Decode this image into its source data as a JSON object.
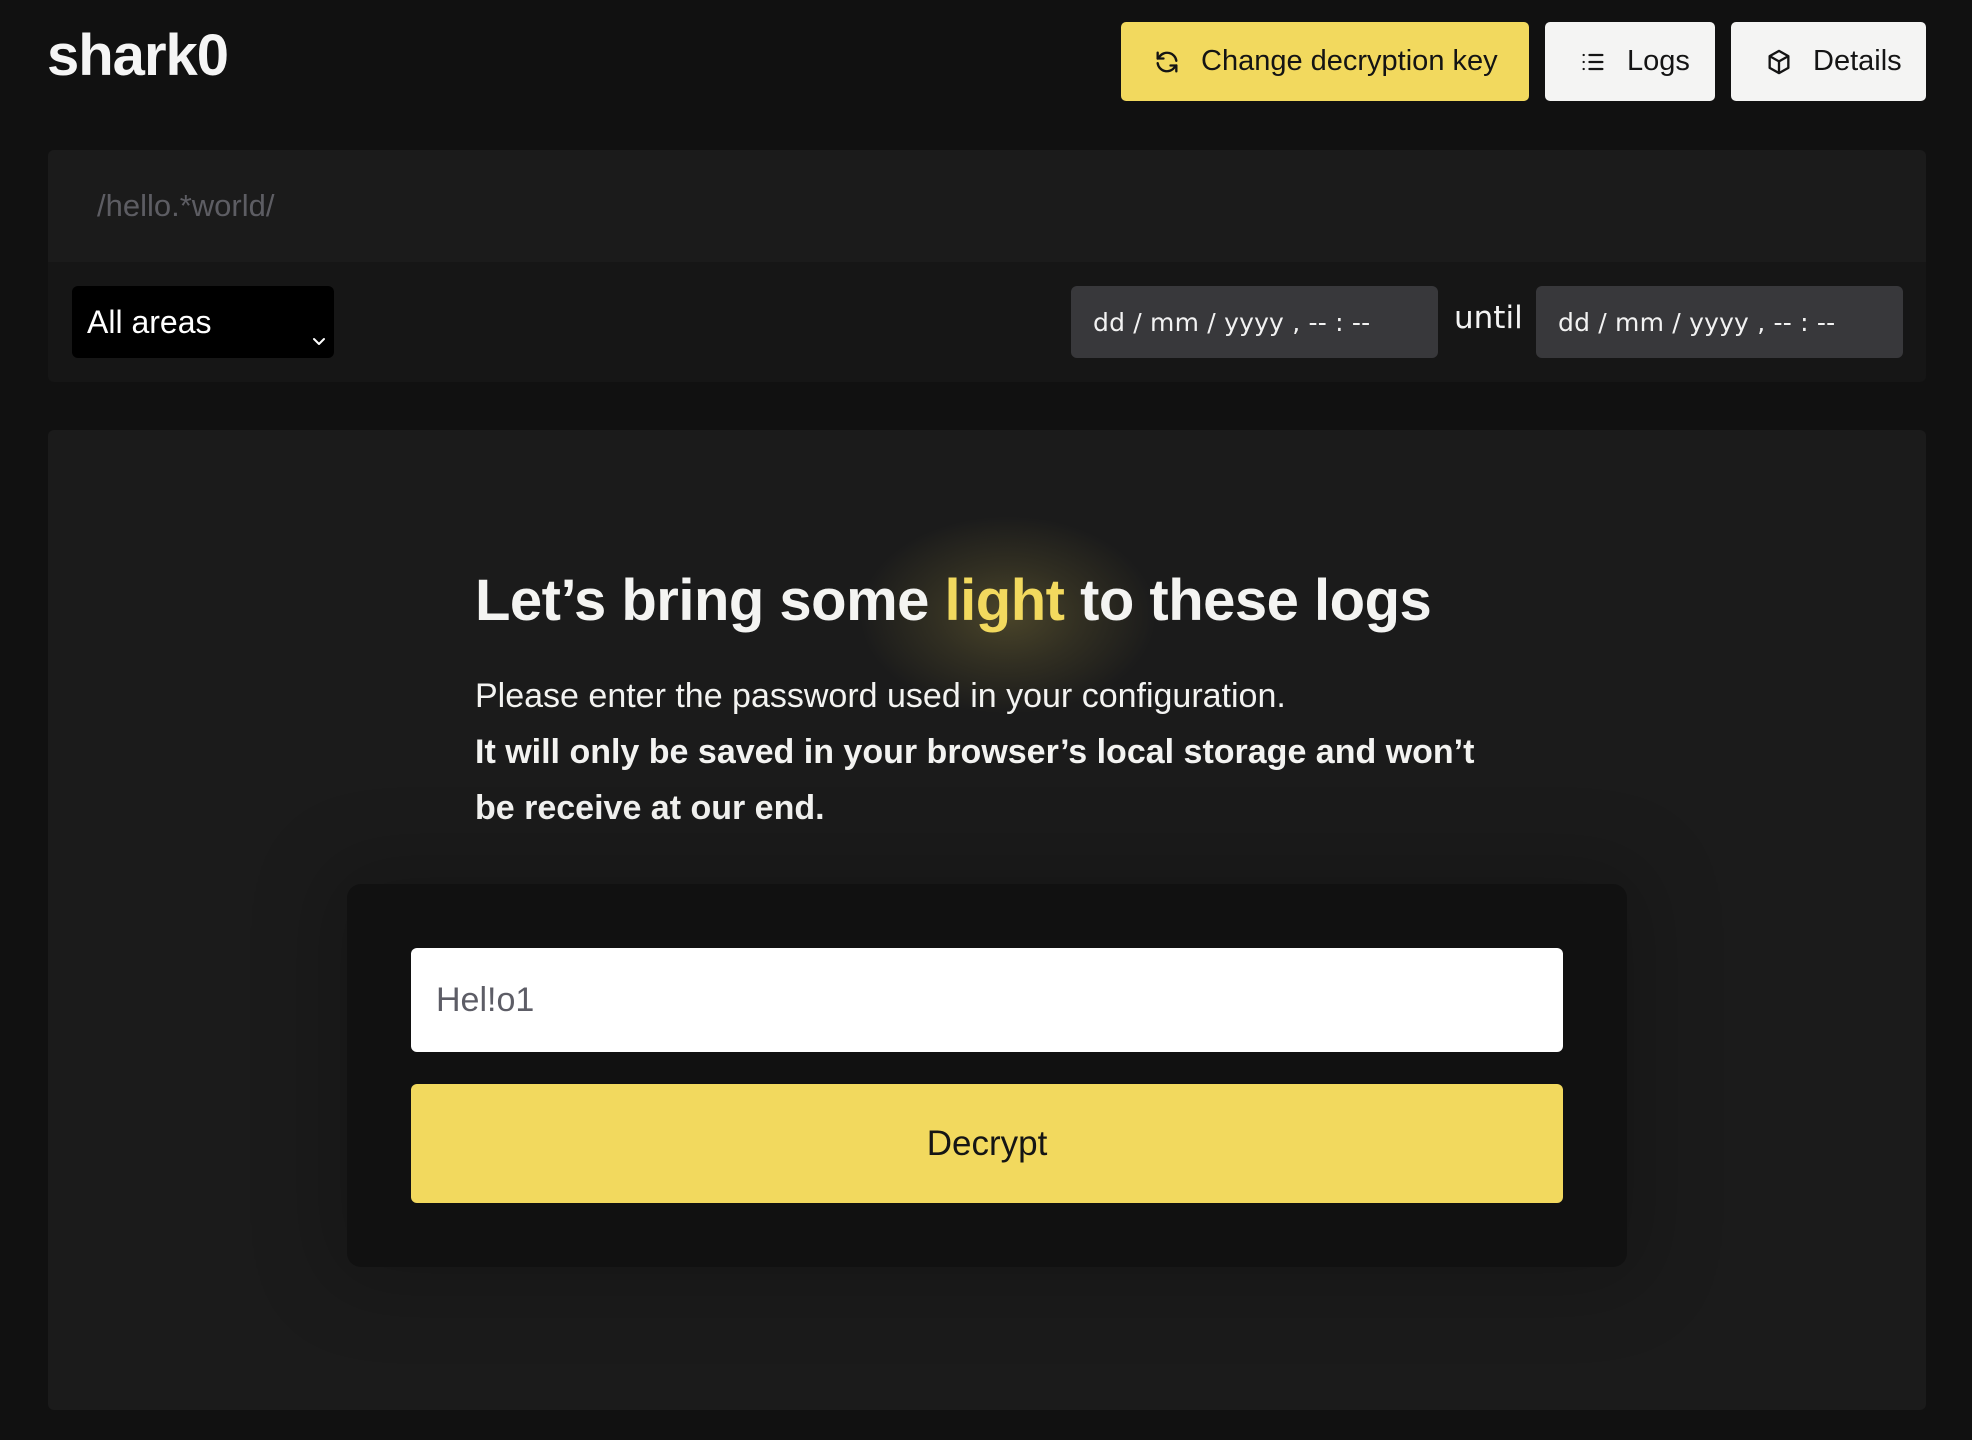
{
  "app": {
    "logo": "shark0"
  },
  "header": {
    "buttons": [
      {
        "label": "Change decryption key",
        "icon": "refresh-icon",
        "variant": "primary"
      },
      {
        "label": "Logs",
        "icon": "list-icon",
        "variant": "secondary"
      },
      {
        "label": "Details",
        "icon": "cube-icon",
        "variant": "secondary"
      }
    ]
  },
  "filters": {
    "search": {
      "value": "",
      "placeholder": "/hello.*world/"
    },
    "area_select": {
      "selected": "All areas"
    },
    "date_from": {
      "placeholder": "dd / mm / yyyy ,  -- : --"
    },
    "until_label": "until",
    "date_to": {
      "placeholder": "dd / mm / yyyy ,  -- : --"
    }
  },
  "main": {
    "heading": {
      "before": "Let’s bring some ",
      "accent": "light",
      "after": " to these logs"
    },
    "description": "Please enter the password used in your configuration.",
    "notice": "It will only be saved in your browser’s local storage and won’t be receive at our end.",
    "password": {
      "value": "Hel!o1"
    },
    "decrypt_label": "Decrypt"
  },
  "colors": {
    "accent": "#f2d95e",
    "page_bg": "#111111",
    "card_bg": "#1b1b1b",
    "input_bg": "#38383b"
  }
}
